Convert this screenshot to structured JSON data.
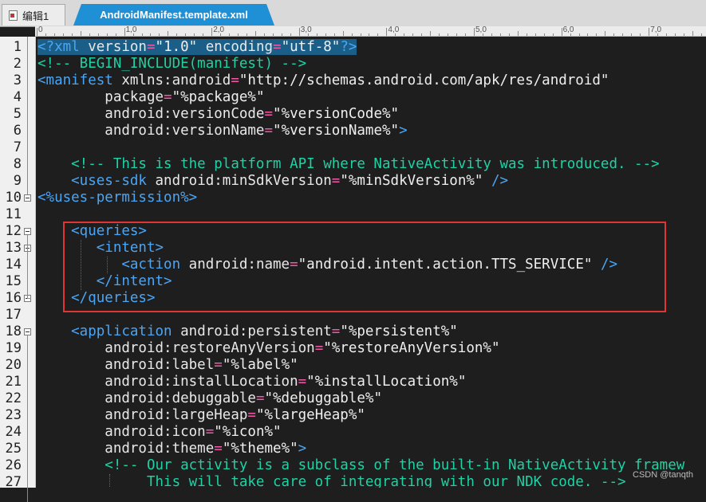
{
  "tabs": [
    {
      "label": "编辑1",
      "active": false
    },
    {
      "label": "AndroidManifest.template.xml",
      "active": true
    }
  ],
  "ruler": {
    "labels": [
      "0",
      "1,0",
      "2,0",
      "3,0",
      "4,0",
      "5,0",
      "6,0",
      "7,0"
    ]
  },
  "lines": [
    {
      "n": "1",
      "segs": [
        [
          "<?xml ",
          "pi"
        ],
        [
          "version",
          "attr"
        ],
        [
          "=",
          "op"
        ],
        [
          "\"1.0\"",
          "val"
        ],
        [
          " encoding",
          "attr"
        ],
        [
          "=",
          "op"
        ],
        [
          "\"utf-8\"",
          "val"
        ],
        [
          "?>",
          "pi"
        ]
      ]
    },
    {
      "n": "2",
      "segs": [
        [
          "<!-- BEGIN_INCLUDE(manifest) -->",
          "com"
        ]
      ]
    },
    {
      "n": "3",
      "segs": [
        [
          "<manifest ",
          "tag"
        ],
        [
          "xmlns:android",
          "attr"
        ],
        [
          "=",
          "op"
        ],
        [
          "\"http://schemas.android.com/apk/res/android\"",
          "val"
        ]
      ]
    },
    {
      "n": "4",
      "segs": [
        [
          "        package",
          "attr"
        ],
        [
          "=",
          "op"
        ],
        [
          "\"%package%\"",
          "val"
        ]
      ]
    },
    {
      "n": "5",
      "segs": [
        [
          "        android:versionCode",
          "attr"
        ],
        [
          "=",
          "op"
        ],
        [
          "\"%versionCode%\"",
          "val"
        ]
      ]
    },
    {
      "n": "6",
      "segs": [
        [
          "        android:versionName",
          "attr"
        ],
        [
          "=",
          "op"
        ],
        [
          "\"%versionName%\"",
          "val"
        ],
        [
          ">",
          "tag"
        ]
      ]
    },
    {
      "n": "7",
      "segs": []
    },
    {
      "n": "8",
      "segs": [
        [
          "    <!-- This is the platform API where NativeActivity was introduced. -->",
          "com"
        ]
      ]
    },
    {
      "n": "9",
      "segs": [
        [
          "    <uses-sdk ",
          "tag"
        ],
        [
          "android:minSdkVersion",
          "attr"
        ],
        [
          "=",
          "op"
        ],
        [
          "\"%minSdkVersion%\"",
          "val"
        ],
        [
          " />",
          "tag"
        ]
      ]
    },
    {
      "n": "10",
      "segs": [
        [
          "<%uses-permission%>",
          "tag"
        ]
      ]
    },
    {
      "n": "11",
      "segs": []
    },
    {
      "n": "12",
      "segs": [
        [
          "    <queries>",
          "tag"
        ]
      ]
    },
    {
      "n": "13",
      "segs": [
        [
          "       <intent>",
          "tag"
        ]
      ]
    },
    {
      "n": "14",
      "segs": [
        [
          "          <action ",
          "tag"
        ],
        [
          "android:name",
          "attr"
        ],
        [
          "=",
          "op"
        ],
        [
          "\"android.intent.action.TTS_SERVICE\"",
          "val"
        ],
        [
          " />",
          "tag"
        ]
      ]
    },
    {
      "n": "15",
      "segs": [
        [
          "       </intent>",
          "tag"
        ]
      ]
    },
    {
      "n": "16",
      "segs": [
        [
          "    </queries>",
          "tag"
        ]
      ]
    },
    {
      "n": "17",
      "segs": []
    },
    {
      "n": "18",
      "segs": [
        [
          "    <application ",
          "tag"
        ],
        [
          "android:persistent",
          "attr"
        ],
        [
          "=",
          "op"
        ],
        [
          "\"%persistent%\"",
          "val"
        ]
      ]
    },
    {
      "n": "19",
      "segs": [
        [
          "        android:restoreAnyVersion",
          "attr"
        ],
        [
          "=",
          "op"
        ],
        [
          "\"%restoreAnyVersion%\"",
          "val"
        ]
      ]
    },
    {
      "n": "20",
      "segs": [
        [
          "        android:label",
          "attr"
        ],
        [
          "=",
          "op"
        ],
        [
          "\"%label%\"",
          "val"
        ]
      ]
    },
    {
      "n": "21",
      "segs": [
        [
          "        android:installLocation",
          "attr"
        ],
        [
          "=",
          "op"
        ],
        [
          "\"%installLocation%\"",
          "val"
        ]
      ]
    },
    {
      "n": "22",
      "segs": [
        [
          "        android:debuggable",
          "attr"
        ],
        [
          "=",
          "op"
        ],
        [
          "\"%debuggable%\"",
          "val"
        ]
      ]
    },
    {
      "n": "23",
      "segs": [
        [
          "        android:largeHeap",
          "attr"
        ],
        [
          "=",
          "op"
        ],
        [
          "\"%largeHeap%\"",
          "val"
        ]
      ]
    },
    {
      "n": "24",
      "segs": [
        [
          "        android:icon",
          "attr"
        ],
        [
          "=",
          "op"
        ],
        [
          "\"%icon%\"",
          "val"
        ]
      ]
    },
    {
      "n": "25",
      "segs": [
        [
          "        android:theme",
          "attr"
        ],
        [
          "=",
          "op"
        ],
        [
          "\"%theme%\"",
          "val"
        ],
        [
          ">",
          "tag"
        ]
      ]
    },
    {
      "n": "26",
      "segs": [
        [
          "        <!-- Our activity is a subclass of the built-in NativeActivity framew",
          "com"
        ]
      ]
    },
    {
      "n": "27",
      "segs": [
        [
          "             This will take care of integrating with our NDK code. -->",
          "com"
        ]
      ]
    }
  ],
  "fold_markers": [
    "10",
    "12",
    "13",
    "16",
    "18"
  ],
  "watermark": "CSDN @tanqth",
  "colors": {
    "tab_active": "#1f8fd6",
    "tag": "#4aa5f5",
    "operator": "#f25aa8",
    "comment": "#1fd1a4",
    "highlight": "#e03535"
  }
}
